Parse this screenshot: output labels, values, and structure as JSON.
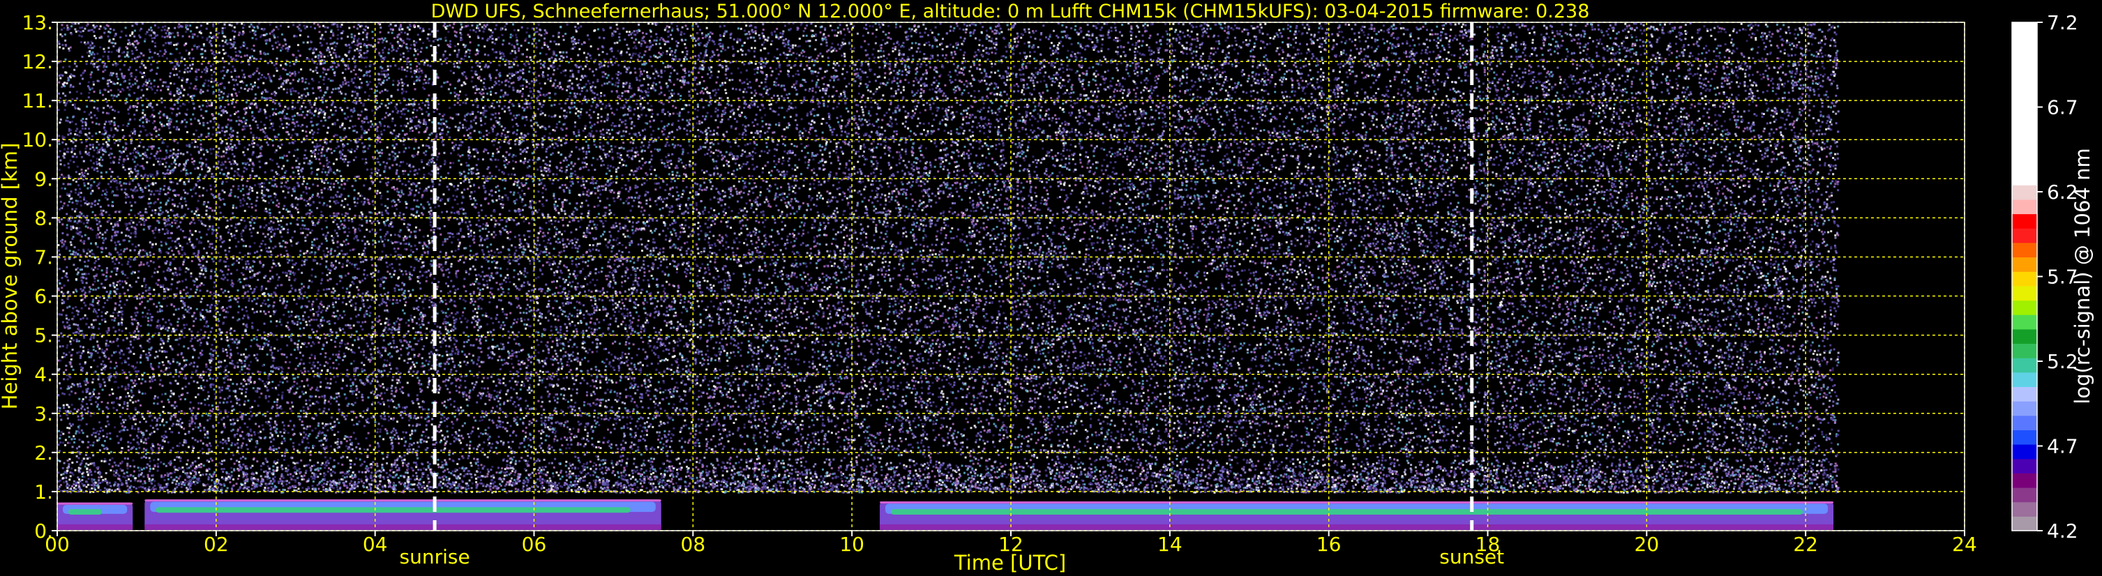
{
  "chart_data": {
    "type": "heatmap",
    "title": "DWD UFS, Schneefernerhaus; 51.000° N 12.000° E, altitude: 0 m    Lufft CHM15k (CHM15kUFS): 03-04-2015    firmware: 0.238",
    "xlabel": "Time [UTC]",
    "ylabel": "Height above ground [km]",
    "xlim": [
      0,
      24
    ],
    "ylim": [
      0,
      13
    ],
    "x_ticks": [
      "00",
      "02",
      "04",
      "06",
      "08",
      "10",
      "12",
      "14",
      "16",
      "18",
      "20",
      "22",
      "24"
    ],
    "y_ticks": [
      "0.",
      "1.",
      "2.",
      "3.",
      "4.",
      "5.",
      "6.",
      "7.",
      "8.",
      "9.",
      "10.",
      "11.",
      "12.",
      "13."
    ],
    "grid": true,
    "data_end_hour": 22.4,
    "events": [
      {
        "label": "sunrise",
        "x": 4.75
      },
      {
        "label": "sunset",
        "x": 17.8
      }
    ],
    "layer_segments": [
      {
        "start": 0.0,
        "end": 0.95,
        "top_km": 0.72,
        "core_km": 0.55
      },
      {
        "start": 1.1,
        "end": 7.6,
        "top_km": 0.8,
        "core_km": 0.6
      },
      {
        "start": 10.35,
        "end": 22.35,
        "top_km": 0.75,
        "core_km": 0.55
      }
    ],
    "colorbar": {
      "label": "log(rc-signal) @ 1064 nm",
      "ticks": [
        "4.2",
        "4.7",
        "5.2",
        "5.7",
        "6.2",
        "6.7",
        "7.2"
      ],
      "range": [
        4.2,
        7.2
      ],
      "colors": [
        "#a89aa8",
        "#9c6f9c",
        "#8b3a8b",
        "#7a007a",
        "#4b00b4",
        "#0000e6",
        "#1e50ff",
        "#5a78ff",
        "#8aa0ff",
        "#b4c3ff",
        "#5fd2e6",
        "#3cc8a0",
        "#32be5a",
        "#14a028",
        "#50dc50",
        "#a0f000",
        "#e6f000",
        "#ffd700",
        "#ffa000",
        "#ff6400",
        "#ff1e1e",
        "#ff0000",
        "#ffb4b4",
        "#f0d2d2",
        "#ffffff"
      ]
    }
  }
}
